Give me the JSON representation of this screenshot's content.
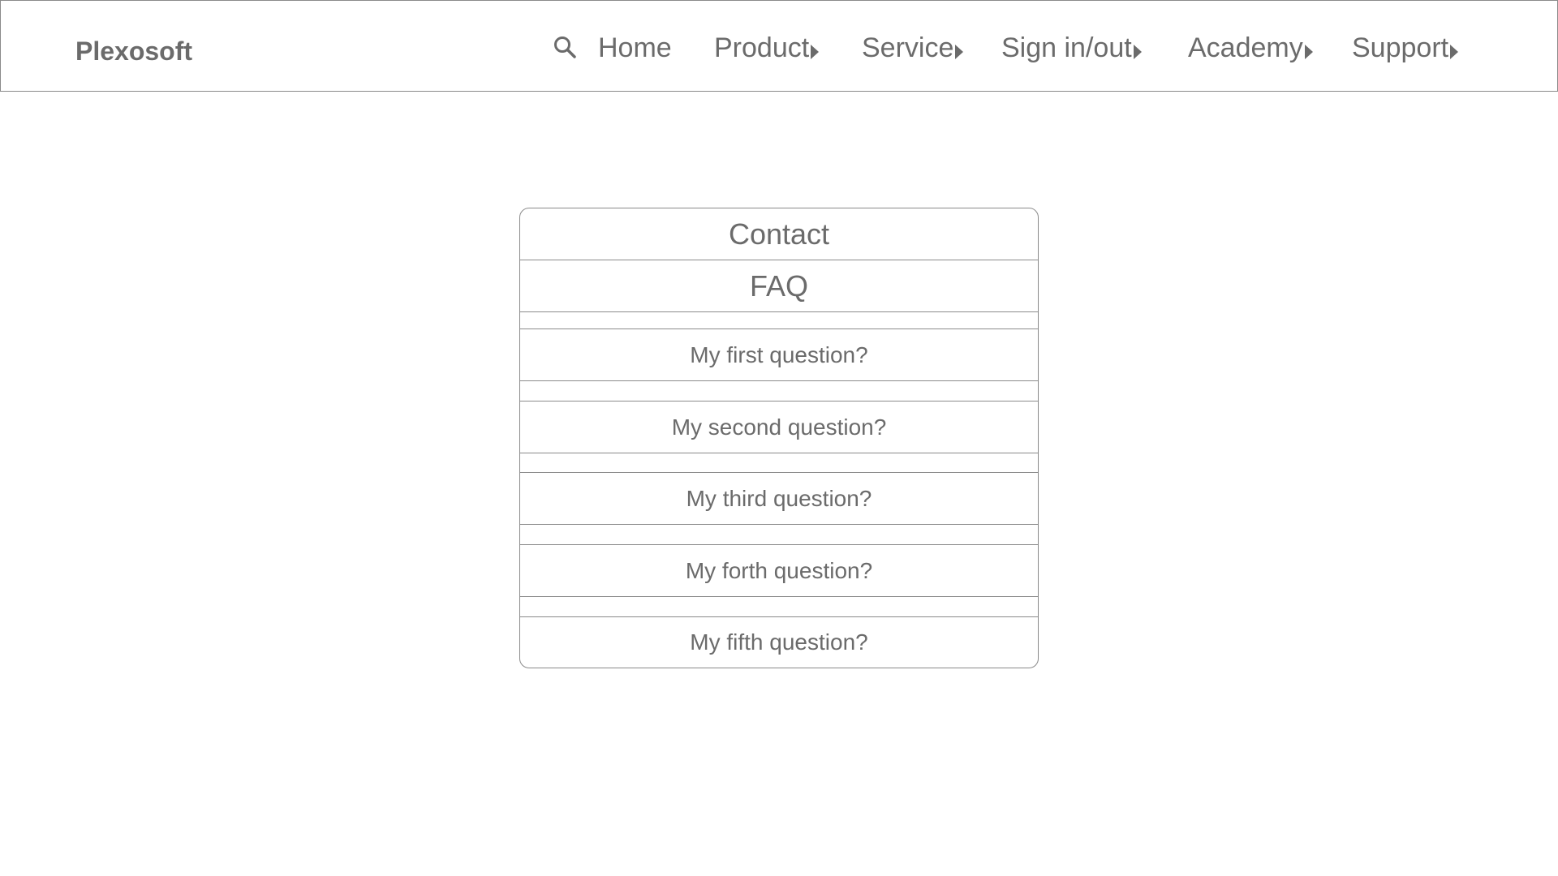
{
  "header": {
    "brand": "Plexosoft",
    "search_icon": "search-icon",
    "nav": [
      {
        "label": "Home",
        "has_caret": false
      },
      {
        "label": "Product",
        "has_caret": true
      },
      {
        "label": "Service",
        "has_caret": true
      },
      {
        "label": "Sign in/out",
        "has_caret": true
      },
      {
        "label": "Academy",
        "has_caret": true
      },
      {
        "label": "Support",
        "has_caret": true
      }
    ]
  },
  "panel": {
    "contact_title": "Contact",
    "faq_title": "FAQ",
    "questions": [
      "My first question?",
      "My second question?",
      "My third question?",
      "My forth question?",
      "My fifth question?"
    ]
  },
  "colors": {
    "text": "#6b6b6b",
    "border": "#8a8a8a",
    "background": "#ffffff"
  }
}
